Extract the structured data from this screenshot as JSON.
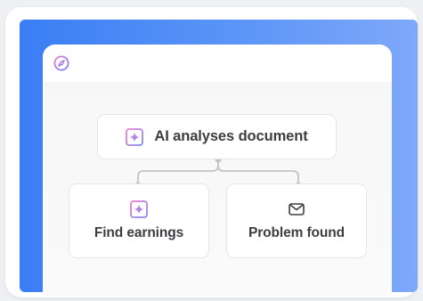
{
  "colors": {
    "panel_gradient_start": "#3a7ef5",
    "panel_gradient_end": "#7fa8f9",
    "node_border": "#e6e6ea",
    "text": "#3d3d42",
    "connector": "#c4c4c8",
    "sparkle_gradient": [
      "#f07ad0",
      "#7d8cf4"
    ]
  },
  "toolbar": {
    "icon": "compass-icon"
  },
  "diagram": {
    "root": {
      "label": "AI analyses document",
      "icon": "sparkle-icon"
    },
    "children": [
      {
        "label": "Find earnings",
        "icon": "sparkle-icon"
      },
      {
        "label": "Problem found",
        "icon": "mail-icon"
      }
    ]
  }
}
